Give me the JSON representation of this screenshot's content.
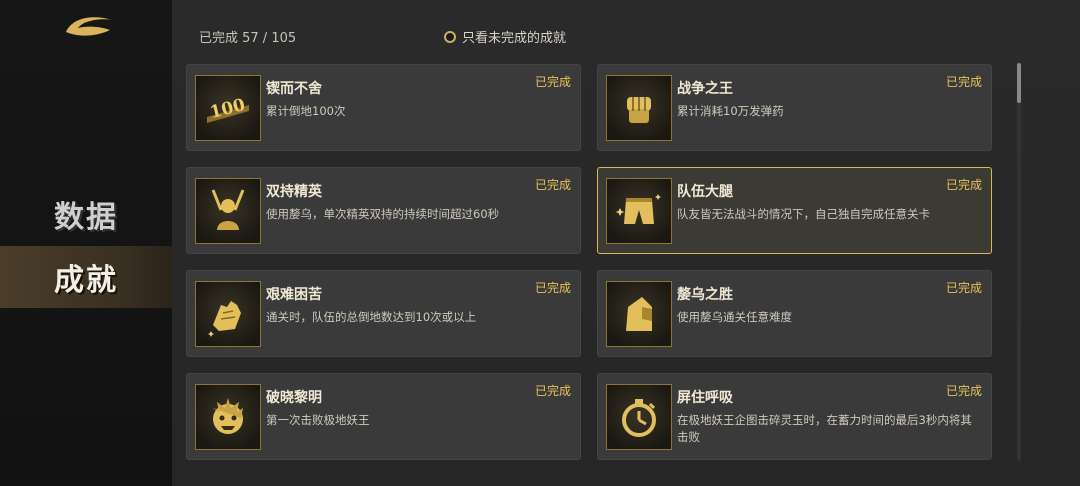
{
  "sidebar": {
    "items": [
      {
        "label": "数据"
      },
      {
        "label": "成就"
      }
    ]
  },
  "header": {
    "progress": "已完成 57 / 105",
    "filter_label": "只看未完成的成就"
  },
  "achievements": [
    {
      "title": "锲而不舍",
      "desc": "累计倒地100次",
      "status": "已完成",
      "icon": "badge-100-icon"
    },
    {
      "title": "战争之王",
      "desc": "累计消耗10万发弹药",
      "status": "已完成",
      "icon": "fist-icon"
    },
    {
      "title": "双持精英",
      "desc": "使用嫠乌，单次精英双持的持续时间超过60秒",
      "status": "已完成",
      "icon": "dual-wield-icon"
    },
    {
      "title": "队伍大腿",
      "desc": "队友皆无法战斗的情况下，自己独自完成任意关卡",
      "status": "已完成",
      "icon": "pants-icon"
    },
    {
      "title": "艰难困苦",
      "desc": "通关时，队伍的总倒地数达到10次或以上",
      "status": "已完成",
      "icon": "glove-icon"
    },
    {
      "title": "嫠乌之胜",
      "desc": "使用嫠乌通关任意难度",
      "status": "已完成",
      "icon": "helmet-icon"
    },
    {
      "title": "破晓黎明",
      "desc": "第一次击败极地妖王",
      "status": "已完成",
      "icon": "beast-head-icon"
    },
    {
      "title": "屏住呼吸",
      "desc": "在极地妖王企图击碎灵玉时，在蓄力时间的最后3秒内将其击败",
      "status": "已完成",
      "icon": "stopwatch-icon"
    }
  ],
  "colors": {
    "accent_gold": "#e6c35a",
    "highlight_border": "#d8b757"
  }
}
